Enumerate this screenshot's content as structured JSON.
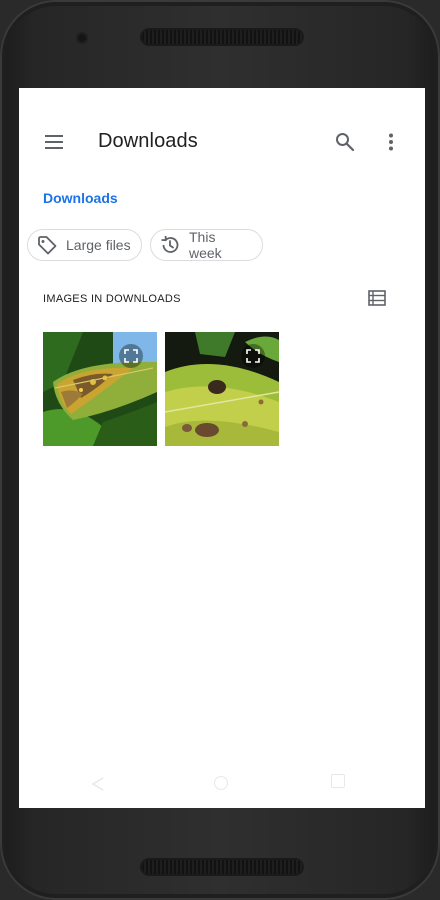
{
  "appbar": {
    "title": "Downloads",
    "menu_icon": "menu-icon",
    "search_icon": "search-icon",
    "more_icon": "more-vert-icon"
  },
  "breadcrumb": {
    "label": "Downloads"
  },
  "chips": [
    {
      "label": "Large files",
      "icon": "tag-icon"
    },
    {
      "label": "This week",
      "icon": "history-icon"
    }
  ],
  "section": {
    "header": "IMAGES IN DOWNLOADS",
    "view_toggle_icon": "list-view-icon"
  },
  "images": [
    {
      "icon": "expand-icon"
    },
    {
      "icon": "expand-icon"
    }
  ],
  "navbar": {
    "back_icon": "nav-back-icon",
    "home_icon": "nav-home-icon",
    "recents_icon": "nav-recents-icon"
  },
  "colors": {
    "accent": "#1a73e8",
    "text_primary": "#202124",
    "text_secondary": "#5f6368",
    "chip_border": "#dadce0"
  }
}
